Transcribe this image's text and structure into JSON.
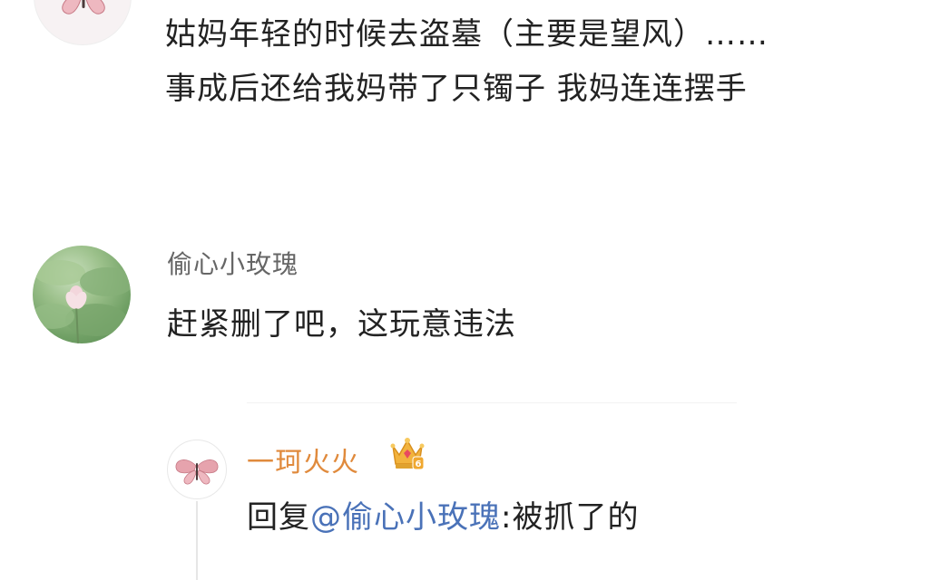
{
  "comments": [
    {
      "avatar_icon": "butterfly-icon",
      "lines": [
        "姑妈年轻的时候去盗墓（主要是望风）……",
        "事成后还给我妈带了只镯子 我妈连连摆手"
      ]
    },
    {
      "username": "偷心小玫瑰",
      "avatar_icon": "lotus-icon",
      "body": "赶紧删了吧，这玩意违法"
    }
  ],
  "reply": {
    "username": "一珂火火",
    "badge_icon": "crown-icon",
    "prefix": "回复",
    "mention": "@偷心小玫瑰",
    "separator": ":",
    "body": "被抓了的",
    "username_color": "#e08a3c",
    "mention_color": "#4a72b8"
  }
}
